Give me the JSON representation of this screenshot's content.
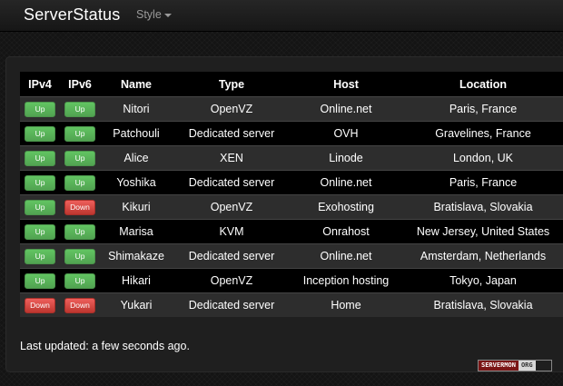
{
  "app": {
    "brand": "ServerStatus",
    "style_menu_label": "Style"
  },
  "table": {
    "headers": [
      "IPv4",
      "IPv6",
      "Name",
      "Type",
      "Host",
      "Location"
    ],
    "rows": [
      {
        "ipv4": "Up",
        "ipv6": "Up",
        "name": "Nitori",
        "type": "OpenVZ",
        "host": "Online.net",
        "location": "Paris, France"
      },
      {
        "ipv4": "Up",
        "ipv6": "Up",
        "name": "Patchouli",
        "type": "Dedicated server",
        "host": "OVH",
        "location": "Gravelines, France"
      },
      {
        "ipv4": "Up",
        "ipv6": "Up",
        "name": "Alice",
        "type": "XEN",
        "host": "Linode",
        "location": "London, UK"
      },
      {
        "ipv4": "Up",
        "ipv6": "Up",
        "name": "Yoshika",
        "type": "Dedicated server",
        "host": "Online.net",
        "location": "Paris, France"
      },
      {
        "ipv4": "Up",
        "ipv6": "Down",
        "name": "Kikuri",
        "type": "OpenVZ",
        "host": "Exohosting",
        "location": "Bratislava, Slovakia"
      },
      {
        "ipv4": "Up",
        "ipv6": "Up",
        "name": "Marisa",
        "type": "KVM",
        "host": "Onrahost",
        "location": "New Jersey, United States"
      },
      {
        "ipv4": "Up",
        "ipv6": "Up",
        "name": "Shimakaze",
        "type": "Dedicated server",
        "host": "Online.net",
        "location": "Amsterdam, Netherlands"
      },
      {
        "ipv4": "Up",
        "ipv6": "Up",
        "name": "Hikari",
        "type": "OpenVZ",
        "host": "Inception hosting",
        "location": "Tokyo, Japan"
      },
      {
        "ipv4": "Down",
        "ipv6": "Down",
        "name": "Yukari",
        "type": "Dedicated server",
        "host": "Home",
        "location": "Bratislava, Slovakia"
      }
    ]
  },
  "footer": {
    "last_updated": "Last updated: a few seconds ago.",
    "logo_part1": "SERVERMON",
    "logo_part2": "ORG"
  },
  "colors": {
    "up": "#5bb75b",
    "down": "#da4f49",
    "header_bg": "#000000",
    "row_alt": "#2d2d2d"
  }
}
